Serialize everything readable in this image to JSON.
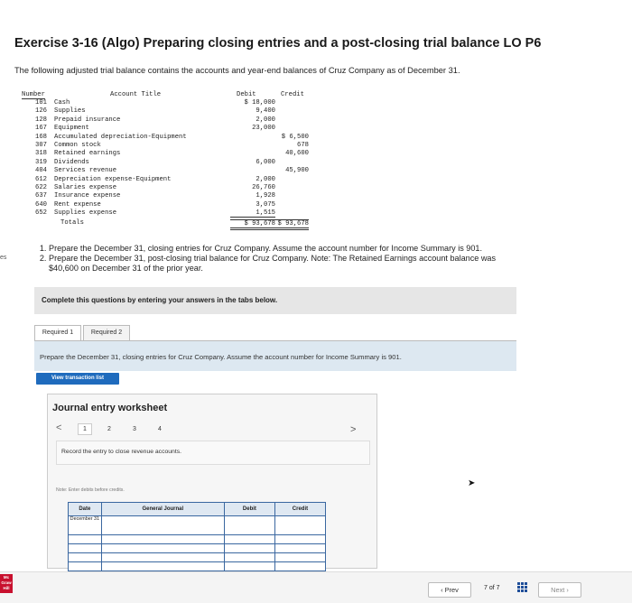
{
  "exercise_title": "Exercise 3-16 (Algo) Preparing closing entries and a post-closing trial balance LO P6",
  "intro": "The following adjusted trial balance contains the accounts and year-end balances of Cruz Company as of December 31.",
  "trial_balance": {
    "headers": {
      "number": "Number",
      "title": "Account Title",
      "debit": "Debit",
      "credit": "Credit"
    },
    "rows": [
      {
        "number": "101",
        "name": "Cash",
        "debit": "$ 18,000",
        "credit": ""
      },
      {
        "number": "126",
        "name": "Supplies",
        "debit": "9,400",
        "credit": ""
      },
      {
        "number": "128",
        "name": "Prepaid insurance",
        "debit": "2,000",
        "credit": ""
      },
      {
        "number": "167",
        "name": "Equipment",
        "debit": "23,000",
        "credit": ""
      },
      {
        "number": "168",
        "name": "Accumulated depreciation-Equipment",
        "debit": "",
        "credit": "$ 6,500"
      },
      {
        "number": "307",
        "name": "Common stock",
        "debit": "",
        "credit": "678"
      },
      {
        "number": "318",
        "name": "Retained earnings",
        "debit": "",
        "credit": "40,600"
      },
      {
        "number": "319",
        "name": "Dividends",
        "debit": "6,000",
        "credit": ""
      },
      {
        "number": "404",
        "name": "Services revenue",
        "debit": "",
        "credit": "45,900"
      },
      {
        "number": "612",
        "name": "Depreciation expense-Equipment",
        "debit": "2,000",
        "credit": ""
      },
      {
        "number": "622",
        "name": "Salaries expense",
        "debit": "26,760",
        "credit": ""
      },
      {
        "number": "637",
        "name": "Insurance expense",
        "debit": "1,928",
        "credit": ""
      },
      {
        "number": "640",
        "name": "Rent expense",
        "debit": "3,075",
        "credit": ""
      },
      {
        "number": "652",
        "name": "Supplies expense",
        "debit": "1,515",
        "credit": ""
      }
    ],
    "totals": {
      "label": "Totals",
      "debit": "$ 93,678",
      "credit": "$ 93,678"
    }
  },
  "left_edge_text": "es",
  "instructions": [
    "Prepare the December 31, closing entries for Cruz Company. Assume the account number for Income Summary is 901.",
    "Prepare the December 31, post-closing trial balance for Cruz Company. Note: The Retained Earnings account balance was $40,600 on December 31 of the prior year."
  ],
  "complete_text": "Complete this questions by entering your answers in the tabs below.",
  "tabs": [
    "Required 1",
    "Required 2"
  ],
  "tab_prompt": "Prepare the December 31, closing entries for Cruz Company. Assume the account number for Income Summary is 901.",
  "view_transaction_list": "View transaction list",
  "worksheet": {
    "title": "Journal entry worksheet",
    "prev_chevron": "<",
    "next_chevron": ">",
    "pages": [
      "1",
      "2",
      "3",
      "4"
    ],
    "active_page": "1",
    "record_text": "Record the entry to close revenue accounts.",
    "note": "Note: Enter debits before credits.",
    "columns": {
      "date": "Date",
      "journal": "General Journal",
      "debit": "Debit",
      "credit": "Credit"
    },
    "date_value": "December 31",
    "row_count": 5
  },
  "nav": {
    "prev": "Prev",
    "page_current": "7",
    "page_of": "of",
    "page_total": "7",
    "next": "Next"
  },
  "brand_badge": "Mc Graw Hill",
  "colors": {
    "accent_blue": "#1f6bbd",
    "table_border": "#3a67a0",
    "brand_red": "#c8102e"
  }
}
